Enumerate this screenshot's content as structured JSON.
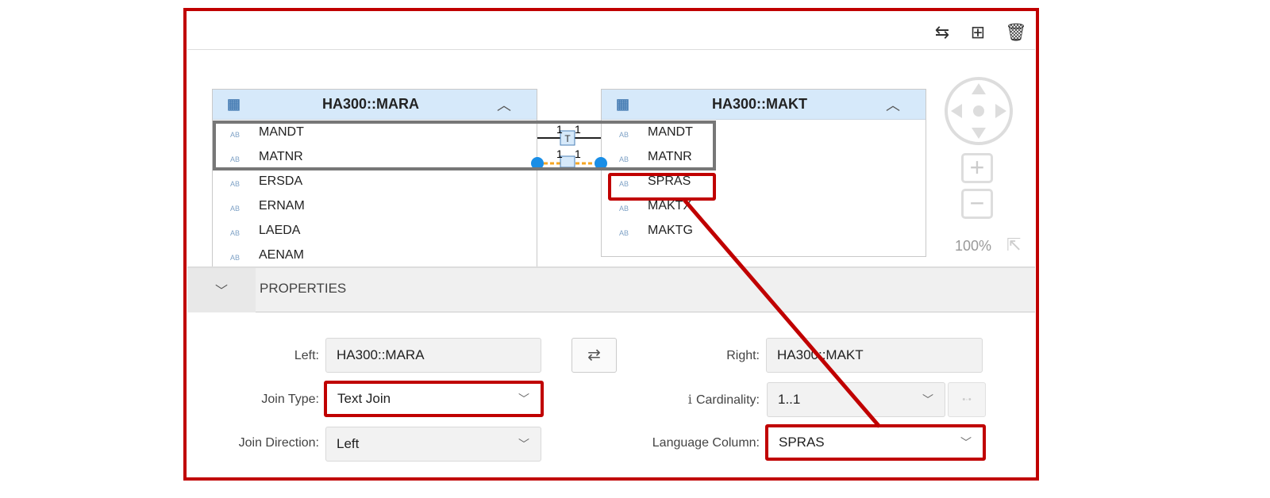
{
  "toolbar": {
    "icons": [
      "auto-layout-icon",
      "hierarchy-icon",
      "trash-icon"
    ]
  },
  "left_table": {
    "title": "HA300::MARA",
    "columns": [
      "MANDT",
      "MATNR",
      "ERSDA",
      "ERNAM",
      "LAEDA",
      "AENAM"
    ],
    "type_badge": "AB"
  },
  "right_table": {
    "title": "HA300::MAKT",
    "columns": [
      "MANDT",
      "MATNR",
      "SPRAS",
      "MAKTX",
      "MAKTG"
    ],
    "type_badge": "AB"
  },
  "joins": [
    {
      "label_left": "1",
      "label_right": "1"
    },
    {
      "label_left": "1",
      "label_right": "1"
    }
  ],
  "zoom": {
    "level": "100%"
  },
  "properties": {
    "title": "PROPERTIES",
    "left_label": "Left:",
    "left_value": "HA300::MARA",
    "right_label": "Right:",
    "right_value": "HA300::MAKT",
    "join_type_label": "Join Type:",
    "join_type_value": "Text Join",
    "cardinality_label": "Cardinality:",
    "cardinality_value": "1..1",
    "join_direction_label": "Join Direction:",
    "join_direction_value": "Left",
    "language_column_label": "Language Column:",
    "language_column_value": "SPRAS"
  },
  "colors": {
    "highlight": "#c00000",
    "header": "#d6e9fa",
    "join_selected": "#f5a623",
    "endpoint": "#1a8ee6"
  }
}
